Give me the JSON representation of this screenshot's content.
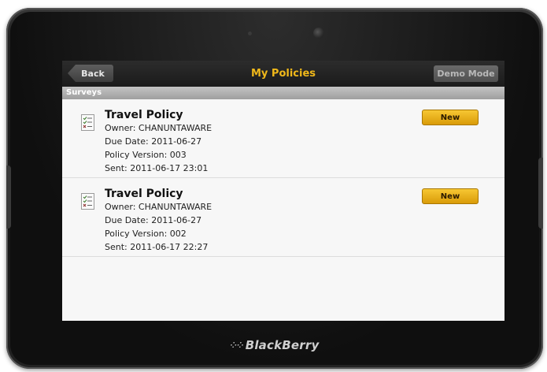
{
  "device": {
    "brand": "BlackBerry"
  },
  "header": {
    "back_label": "Back",
    "title": "My Policies",
    "demo_label": "Demo Mode"
  },
  "section": {
    "label": "Surveys"
  },
  "items": [
    {
      "title": "Travel Policy",
      "owner": "Owner: CHANUNTAWARE",
      "due": "Due Date: 2011-06-27",
      "version": "Policy Version: 003",
      "sent": "Sent: 2011-06-17 23:01",
      "status_label": "New"
    },
    {
      "title": "Travel Policy",
      "owner": "Owner: CHANUNTAWARE",
      "due": "Due Date: 2011-06-27",
      "version": "Policy Version: 002",
      "sent": "Sent: 2011-06-17 22:27",
      "status_label": "New"
    }
  ],
  "colors": {
    "title_accent": "#f0b81a",
    "new_button": "#e8aa14"
  }
}
